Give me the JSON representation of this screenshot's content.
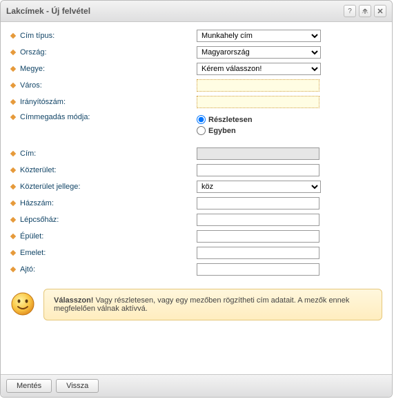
{
  "window": {
    "title": "Lakcímek - Új felvétel"
  },
  "form": {
    "cim_tipus": {
      "label": "Cím típus:",
      "value": "Munkahely cím"
    },
    "orszag": {
      "label": "Ország:",
      "value": "Magyarország"
    },
    "megye": {
      "label": "Megye:",
      "value": "Kérem válasszon!"
    },
    "varos": {
      "label": "Város:",
      "value": ""
    },
    "iranyitoszam": {
      "label": "Irányítószám:",
      "value": ""
    },
    "cimmegadas": {
      "label": "Címmegadás módja:",
      "options": {
        "reszletesen": "Részletesen",
        "egyben": "Egyben"
      },
      "selected": "reszletesen"
    },
    "cim": {
      "label": "Cím:",
      "value": ""
    },
    "kozterulet": {
      "label": "Közterület:",
      "value": ""
    },
    "kozterulet_jellege": {
      "label": "Közterület jellege:",
      "value": "köz"
    },
    "hazszam": {
      "label": "Házszám:",
      "value": ""
    },
    "lepcsohaz": {
      "label": "Lépcsőház:",
      "value": ""
    },
    "epulet": {
      "label": "Épület:",
      "value": ""
    },
    "emelet": {
      "label": "Emelet:",
      "value": ""
    },
    "ajto": {
      "label": "Ajtó:",
      "value": ""
    }
  },
  "hint": {
    "bold": "Válasszon!",
    "rest": " Vagy részletesen, vagy egy mezőben rögzítheti cím adatait. A mezők ennek megfelelően válnak aktívvá."
  },
  "footer": {
    "save": "Mentés",
    "back": "Vissza"
  }
}
